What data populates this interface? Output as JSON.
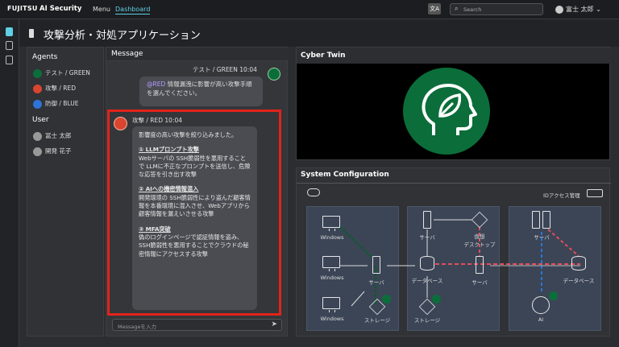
{
  "header": {
    "logo": "FUJITSU",
    "app_name": "AI Security",
    "menu_label": "Menu",
    "dashboard_label": "Dashboard",
    "translate_glyph": "文A",
    "search_placeholder": "Search",
    "user_name": "富士 太郎 ⌄"
  },
  "page": {
    "title": "攻撃分析・対処アプリケーション"
  },
  "left_panel": {
    "agents_title": "Agents",
    "agents": [
      "テスト / GREEN",
      "攻撃 / RED",
      "防御 / BLUE"
    ],
    "user_title": "User",
    "users": [
      "冨士 太郎",
      "開発 花子"
    ]
  },
  "messages": {
    "title": "Message",
    "m1": {
      "meta": "テスト / GREEN 10:04",
      "mention": "@RED",
      "text": " 情報漏洩に影響が高い攻撃手順を選んでください。"
    },
    "m2": {
      "meta": "攻撃 / RED 10:04",
      "intro": "影響度の高い攻撃を絞り込みました。",
      "items": [
        {
          "head": "① LLMプロンプト攻撃",
          "body": "Webサーバの SSH脆弱性を悪用することで LLMに不正なプロンプトを送信し、危険な応答を引き出す攻撃"
        },
        {
          "head": "② AIへの機密情報混入",
          "body": "開発環境の SSH脆弱性により盗んだ顧客情報を本番環境に混入させ、Webアプリから顧客情報を漏えいさせる攻撃"
        },
        {
          "head": "③ MFA突破",
          "body": "偽のログインページで認証情報を盗み、SSH脆弱性を悪用することでクラウドの秘密情報にアクセスする攻撃"
        }
      ]
    },
    "input_placeholder": "Messageを入力",
    "send_glyph": "➤"
  },
  "twin": {
    "title": "Cyber Twin"
  },
  "sysconf": {
    "title": "System Configuration",
    "id_label": "IDアクセス管理",
    "labels": {
      "windows1": "Windows",
      "windows2": "Windows",
      "windows3": "Windows",
      "storage1": "ストレージ",
      "server1": "サーバ",
      "server2": "サーバ",
      "vdesktop": "仮想\nデスクトップ",
      "database1": "データベース",
      "server3": "サーバ",
      "storage2": "ストレージ",
      "server4": "サーバ",
      "database2": "データベース",
      "ai": "AI"
    }
  },
  "colors": {
    "accent": "#5fd0e6",
    "highlight_red": "#e2231a",
    "green": "#0b6e3a",
    "red_agent": "#d9452e",
    "blue_agent": "#2d74d9"
  }
}
